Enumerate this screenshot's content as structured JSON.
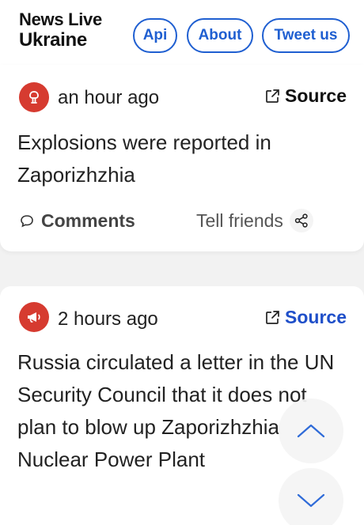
{
  "header": {
    "logo_line1": "News Live",
    "logo_line2": "Ukraine",
    "nav": {
      "api": "Api",
      "about": "About",
      "tweet": "Tweet us"
    }
  },
  "posts": [
    {
      "icon": "explosion-icon",
      "time": "an hour ago",
      "source_label": "Source",
      "source_color": "#111111",
      "text": "Explosions were reported in Zaporizhzhia",
      "comments_label": "Comments",
      "share_label": "Tell friends"
    },
    {
      "icon": "megaphone-icon",
      "time": "2 hours ago",
      "source_label": "Source",
      "source_color": "#1f4fc9",
      "text": "Russia circulated a letter in the UN Security Council that it does not plan to blow up Zaporizhzhia Nuclear Power Plant"
    }
  ],
  "colors": {
    "accent": "#1f5fd1",
    "avatar": "#d63b30"
  }
}
